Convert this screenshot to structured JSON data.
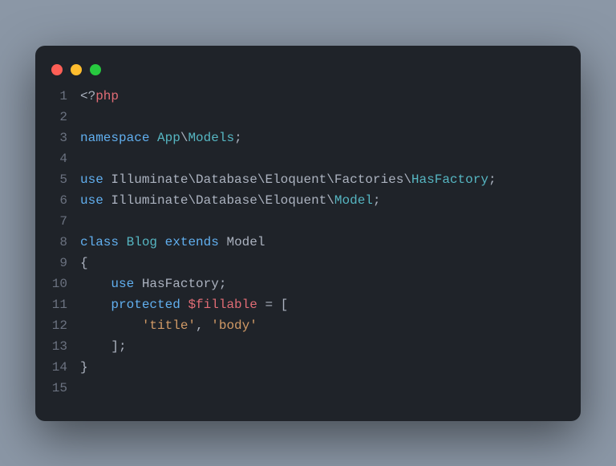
{
  "window": {
    "dots": [
      "red",
      "yellow",
      "green"
    ]
  },
  "code": {
    "lines": [
      {
        "num": "1",
        "tokens": [
          {
            "t": "<?",
            "c": "tk-punct"
          },
          {
            "t": "php",
            "c": "tk-php"
          }
        ]
      },
      {
        "num": "2",
        "tokens": []
      },
      {
        "num": "3",
        "tokens": [
          {
            "t": "namespace",
            "c": "tk-keyword"
          },
          {
            "t": " ",
            "c": ""
          },
          {
            "t": "App",
            "c": "tk-classname"
          },
          {
            "t": "\\",
            "c": "tk-punct"
          },
          {
            "t": "Models",
            "c": "tk-classname"
          },
          {
            "t": ";",
            "c": "tk-punct"
          }
        ]
      },
      {
        "num": "4",
        "tokens": []
      },
      {
        "num": "5",
        "tokens": [
          {
            "t": "use",
            "c": "tk-keyword"
          },
          {
            "t": " ",
            "c": ""
          },
          {
            "t": "Illuminate",
            "c": "tk-namespace"
          },
          {
            "t": "\\",
            "c": "tk-punct"
          },
          {
            "t": "Database",
            "c": "tk-namespace"
          },
          {
            "t": "\\",
            "c": "tk-punct"
          },
          {
            "t": "Eloquent",
            "c": "tk-namespace"
          },
          {
            "t": "\\",
            "c": "tk-punct"
          },
          {
            "t": "Factories",
            "c": "tk-namespace"
          },
          {
            "t": "\\",
            "c": "tk-punct"
          },
          {
            "t": "HasFactory",
            "c": "tk-classname"
          },
          {
            "t": ";",
            "c": "tk-punct"
          }
        ]
      },
      {
        "num": "6",
        "tokens": [
          {
            "t": "use",
            "c": "tk-keyword"
          },
          {
            "t": " ",
            "c": ""
          },
          {
            "t": "Illuminate",
            "c": "tk-namespace"
          },
          {
            "t": "\\",
            "c": "tk-punct"
          },
          {
            "t": "Database",
            "c": "tk-namespace"
          },
          {
            "t": "\\",
            "c": "tk-punct"
          },
          {
            "t": "Eloquent",
            "c": "tk-namespace"
          },
          {
            "t": "\\",
            "c": "tk-punct"
          },
          {
            "t": "Model",
            "c": "tk-classname"
          },
          {
            "t": ";",
            "c": "tk-punct"
          }
        ]
      },
      {
        "num": "7",
        "tokens": []
      },
      {
        "num": "8",
        "tokens": [
          {
            "t": "class",
            "c": "tk-keyword"
          },
          {
            "t": " ",
            "c": ""
          },
          {
            "t": "Blog",
            "c": "tk-classname"
          },
          {
            "t": " ",
            "c": ""
          },
          {
            "t": "extends",
            "c": "tk-keyword"
          },
          {
            "t": " ",
            "c": ""
          },
          {
            "t": "Model",
            "c": "tk-namespace"
          }
        ]
      },
      {
        "num": "9",
        "tokens": [
          {
            "t": "{",
            "c": "tk-punct"
          }
        ]
      },
      {
        "num": "10",
        "tokens": [
          {
            "t": "    ",
            "c": ""
          },
          {
            "t": "use",
            "c": "tk-keyword"
          },
          {
            "t": " ",
            "c": ""
          },
          {
            "t": "HasFactory",
            "c": "tk-namespace"
          },
          {
            "t": ";",
            "c": "tk-punct"
          }
        ]
      },
      {
        "num": "11",
        "tokens": [
          {
            "t": "    ",
            "c": ""
          },
          {
            "t": "protected",
            "c": "tk-keyword"
          },
          {
            "t": " ",
            "c": ""
          },
          {
            "t": "$fillable",
            "c": "tk-var"
          },
          {
            "t": " = [",
            "c": "tk-op"
          }
        ]
      },
      {
        "num": "12",
        "tokens": [
          {
            "t": "        ",
            "c": ""
          },
          {
            "t": "'title'",
            "c": "tk-string"
          },
          {
            "t": ", ",
            "c": "tk-punct"
          },
          {
            "t": "'body'",
            "c": "tk-string"
          }
        ]
      },
      {
        "num": "13",
        "tokens": [
          {
            "t": "    ];",
            "c": "tk-punct"
          }
        ]
      },
      {
        "num": "14",
        "tokens": [
          {
            "t": "}",
            "c": "tk-punct"
          }
        ]
      },
      {
        "num": "15",
        "tokens": []
      }
    ]
  }
}
